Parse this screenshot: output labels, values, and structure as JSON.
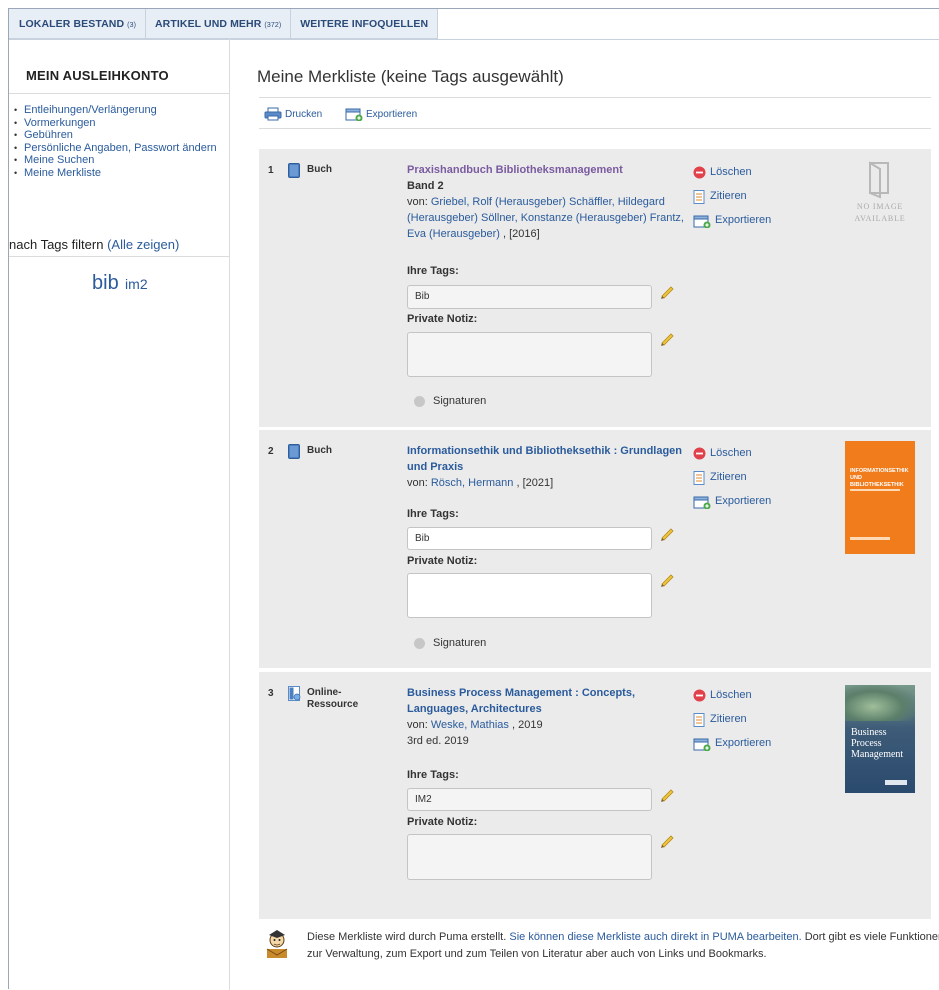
{
  "tabs": [
    {
      "label": "LOKALER BESTAND",
      "count": "(3)"
    },
    {
      "label": "ARTIKEL UND MEHR",
      "count": "(372)"
    },
    {
      "label": "WEITERE INFOQUELLEN",
      "count": ""
    }
  ],
  "sidebar": {
    "title": "MEIN AUSLEIHKONTO",
    "items": [
      {
        "label": "Entleihungen/Verlängerung"
      },
      {
        "label": "Vormerkungen"
      },
      {
        "label": "Gebühren"
      },
      {
        "label": "Persönliche Angaben, Passwort ändern"
      },
      {
        "label": "Meine Suchen"
      },
      {
        "label": "Meine Merkliste"
      }
    ],
    "filter_label": "nach Tags filtern",
    "filter_link": "(Alle zeigen)",
    "tags": [
      {
        "label": "bib",
        "size": "big"
      },
      {
        "label": "im2",
        "size": "small"
      }
    ]
  },
  "main": {
    "title": "Meine Merkliste (keine Tags ausgewählt)",
    "toolbar": {
      "print_label": "Drucken",
      "export_label": "Exportieren"
    },
    "items": [
      {
        "num": "1",
        "type": "Buch",
        "title": "Praxishandbuch Bibliotheksmanagement",
        "band": "Band 2",
        "by_prefix": "von:",
        "authors": "Griebel, Rolf (Herausgeber) Schäffler, Hildegard (Herausgeber) Söllner, Konstanze (Herausgeber) Frantz, Eva (Herausgeber)",
        "year": ", [2016]",
        "tags_label": "Ihre Tags:",
        "tags_value": "Bib",
        "notes_label": "Private Notiz:",
        "notes_value": "",
        "sig_label": "Signaturen",
        "cover": "NO IMAGE AVAILABLE"
      },
      {
        "num": "2",
        "type": "Buch",
        "title": "Informationsethik und Bibliotheksethik : Grundlagen und Praxis",
        "by_prefix": "von:",
        "authors": "Rösch, Hermann",
        "year": ", [2021]",
        "tags_label": "Ihre Tags:",
        "tags_value": "Bib",
        "notes_label": "Private Notiz:",
        "notes_value": "",
        "sig_label": "Signaturen",
        "cover_title": "INFORMATIONSETHIK UND BIBLIOTHEKSETHIK"
      },
      {
        "num": "3",
        "type": "Online-Ressource",
        "title": "Business Process Management : Concepts, Languages, Architectures",
        "by_prefix": "von:",
        "authors": "Weske, Mathias",
        "year": ", 2019",
        "edition": "3rd ed. 2019",
        "tags_label": "Ihre Tags:",
        "tags_value": "IM2",
        "notes_label": "Private Notiz:",
        "notes_value": "",
        "cover_title": "Business Process Management"
      }
    ],
    "actions": {
      "delete": "Löschen",
      "cite": "Zitieren",
      "export": "Exportieren"
    },
    "footer": {
      "text1": "Diese Merkliste wird durch Puma erstellt.",
      "link": "Sie können diese Merkliste auch direkt in PUMA bearbeiten.",
      "text2": "Dort gibt es viele Funktionen zur Verwaltung, zum Export und zum Teilen von Literatur aber auch von Links und Bookmarks."
    }
  },
  "colors": {
    "link": "#2a5b9c",
    "item_bg": "#ebebeb",
    "delete_red": "#e0414a",
    "cover_orange": "#f07c1c"
  }
}
